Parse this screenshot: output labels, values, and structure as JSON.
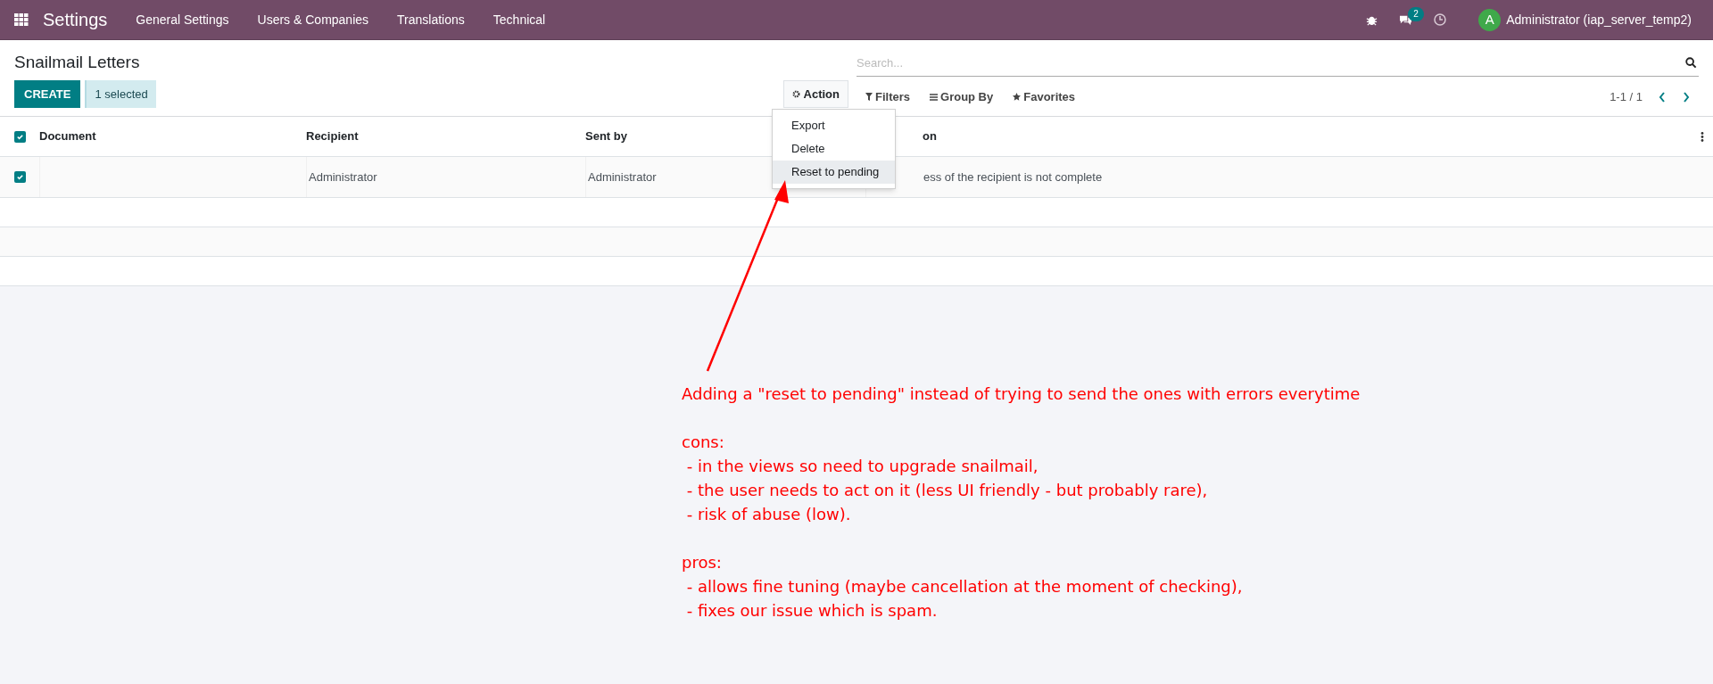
{
  "navbar": {
    "app_name": "Settings",
    "menu": [
      "General Settings",
      "Users & Companies",
      "Translations",
      "Technical"
    ],
    "messages_badge": "2",
    "user": {
      "initial": "A",
      "name": "Administrator (iap_server_temp2)"
    }
  },
  "control_panel": {
    "title": "Snailmail Letters",
    "create_button": "CREATE",
    "selected_count": "1 selected",
    "action_button": "Action",
    "search": {
      "placeholder": "Search..."
    },
    "filters": [
      "Filters",
      "Group By",
      "Favorites"
    ],
    "pager": "1-1 / 1"
  },
  "action_menu": [
    {
      "label": "Export",
      "selected": false
    },
    {
      "label": "Delete",
      "selected": false
    },
    {
      "label": "Reset to pending",
      "selected": true
    }
  ],
  "table": {
    "all_checked": true,
    "columns": [
      "Document",
      "Recipient",
      "Sent by",
      "on"
    ],
    "rows": [
      {
        "checked": true,
        "cells": [
          "",
          "Administrator",
          "Administrator",
          "ess of the recipient is not complete"
        ]
      }
    ]
  },
  "annotation": {
    "heading": "Adding a \"reset to pending\" instead of trying to send the ones with errors everytime",
    "sections": [
      {
        "title": "cons:",
        "items": [
          " - in the views so need to upgrade snailmail,",
          " - the user needs to act on it (less UI friendly - but probably rare),",
          " - risk of abuse (low)."
        ]
      },
      {
        "title": "pros:",
        "items": [
          " - allows fine tuning (maybe cancellation at the moment of checking),",
          " - fixes our issue which is spam."
        ]
      }
    ]
  }
}
